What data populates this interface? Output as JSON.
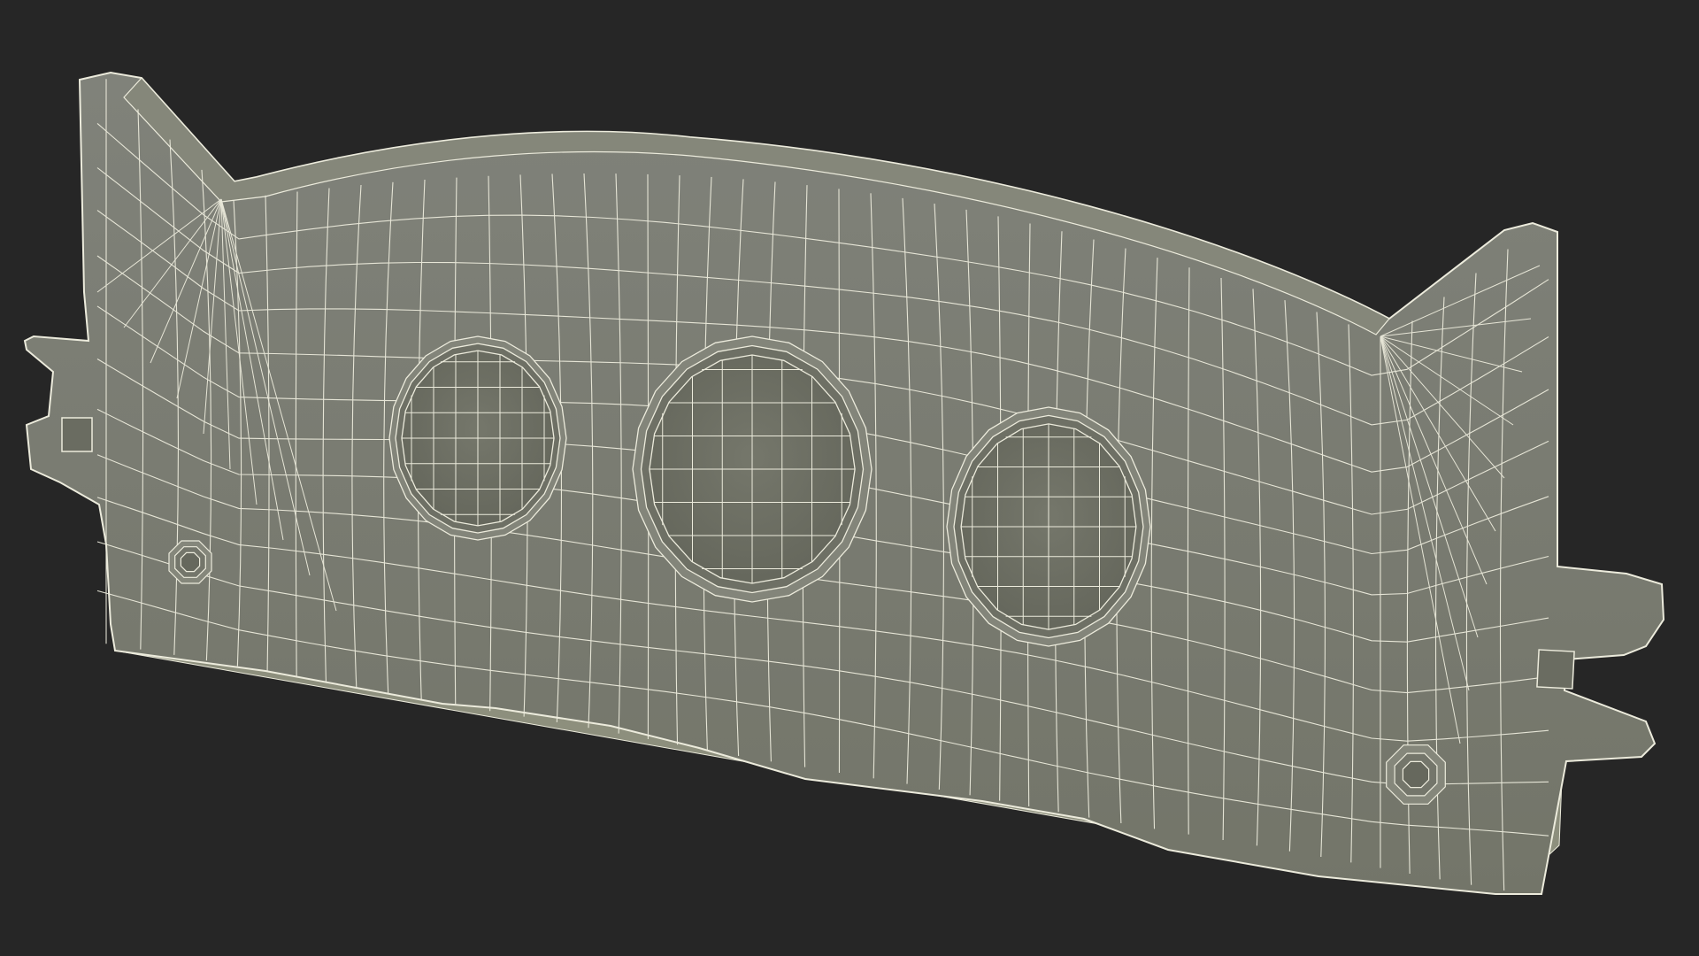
{
  "scene": {
    "background_color": "#262626",
    "subject": "wireframe-render-brake-pad",
    "surface_color": "#7b7d70",
    "rim_color": "#8f917f",
    "shadow_color": "#5f6157",
    "wire_color": "#ecebdc",
    "circular_openings": 3,
    "bolt_bosses": 2
  }
}
